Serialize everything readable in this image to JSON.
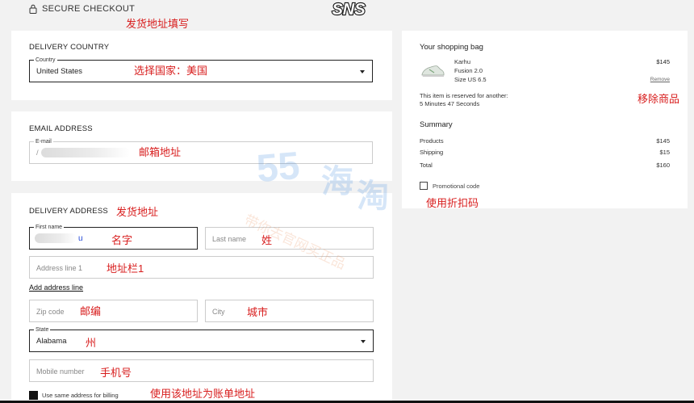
{
  "header": {
    "secure_label": "SECURE CHECKOUT",
    "logo_text": "SNS",
    "annotation": "发货地址填写"
  },
  "delivery_country": {
    "title": "DELIVERY COUNTRY",
    "field_label": "Country",
    "value": "United States",
    "annotation": "选择国家：美国"
  },
  "email": {
    "title": "EMAIL ADDRESS",
    "field_label": "E-mail",
    "value_prefix": "/",
    "annotation": "邮箱地址"
  },
  "delivery_address": {
    "title": "DELIVERY ADDRESS",
    "title_annotation": "发货地址",
    "first_name_label": "First name",
    "first_name_visible": "u",
    "first_name_annotation": "名字",
    "last_name_placeholder": "Last name",
    "last_name_annotation": "姓",
    "address_line_placeholder": "Address line 1",
    "address_line_annotation": "地址栏1",
    "add_address_line": "Add address line",
    "zip_placeholder": "Zip code",
    "zip_annotation": "邮编",
    "city_placeholder": "City",
    "city_annotation": "城市",
    "state_label": "State",
    "state_value": "Alabama",
    "state_annotation": "州",
    "mobile_placeholder": "Mobile number",
    "mobile_annotation": "手机号",
    "same_billing_label": "Use same address for billing",
    "same_billing_annotation": "使用该地址为账单地址"
  },
  "bag": {
    "title": "Your shopping bag",
    "product": {
      "brand": "Karhu",
      "name": "Fusion 2.0",
      "size": "Size US 6.5",
      "price": "$145",
      "remove_label": "Remove"
    },
    "remove_annotation": "移除商品",
    "reserved_line1": "This item is reserved for another:",
    "reserved_line2": "5 Minutes 47 Seconds",
    "summary_title": "Summary",
    "summary": [
      {
        "label": "Products",
        "value": "$145"
      },
      {
        "label": "Shipping",
        "value": "$15"
      },
      {
        "label": "Total",
        "value": "$160"
      }
    ],
    "promo_label": "Promotional code",
    "promo_annotation": "使用折扣码"
  },
  "watermark": {
    "number": "55",
    "chars": [
      "海",
      "淘"
    ],
    "subtitle": "带你去官网买正品"
  },
  "colors": {
    "annotation_red": "#d81e1e",
    "annotation_blue": "#2146d6",
    "watermark_blue": "#4a90e2",
    "watermark_orange": "#e9905d"
  }
}
